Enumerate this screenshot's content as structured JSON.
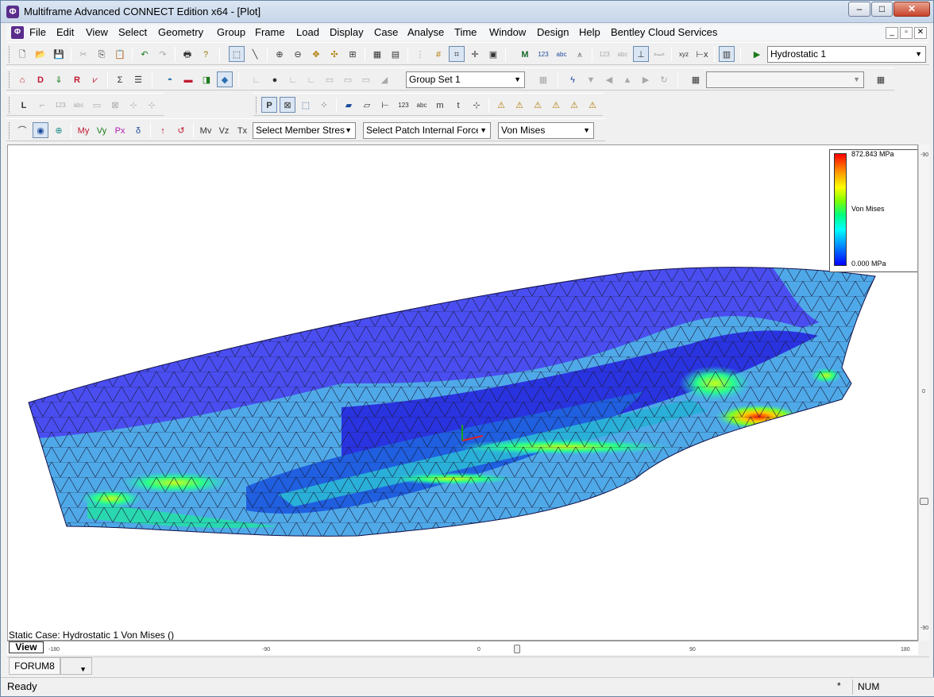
{
  "window": {
    "title": "Multiframe Advanced CONNECT Edition x64 - [Plot]",
    "min": "–",
    "max": "□",
    "close": "✕"
  },
  "menu": [
    "File",
    "Edit",
    "View",
    "Select",
    "Geometry",
    "Group",
    "Frame",
    "Load",
    "Display",
    "Case",
    "Analyse",
    "Time",
    "Window",
    "Design",
    "Help",
    "Bentley Cloud Services"
  ],
  "mdi_controls": [
    "_",
    "▫",
    "✕"
  ],
  "toolbars": {
    "case_select": "Hydrostatic 1",
    "group_set": "Group Set 1",
    "group_blank": "",
    "member_stress": "Select Member Stres",
    "patch_force": "Select Patch Internal Force",
    "result_type": "Von Mises"
  },
  "plot": {
    "caption": "Static Case: Hydrostatic 1  Von Mises ()",
    "legend": {
      "max": "872.843 MPa",
      "label": "Von Mises",
      "min": "0.000 MPa"
    },
    "colors": {
      "low": "#0000ff",
      "mid": "#00ffff",
      "high": "#ff0000",
      "hull_top": "#4a4ef0",
      "hull_light": "#4fa9e8"
    }
  },
  "ruler": {
    "view_label": "View",
    "h_ticks": [
      "-180",
      "-90",
      "0",
      "90",
      "180"
    ],
    "v_ticks": [
      "-90",
      "0",
      "90"
    ]
  },
  "tabs": {
    "active": "FORUM8"
  },
  "status": {
    "text": "Ready",
    "star": "*",
    "num": "NUM"
  }
}
